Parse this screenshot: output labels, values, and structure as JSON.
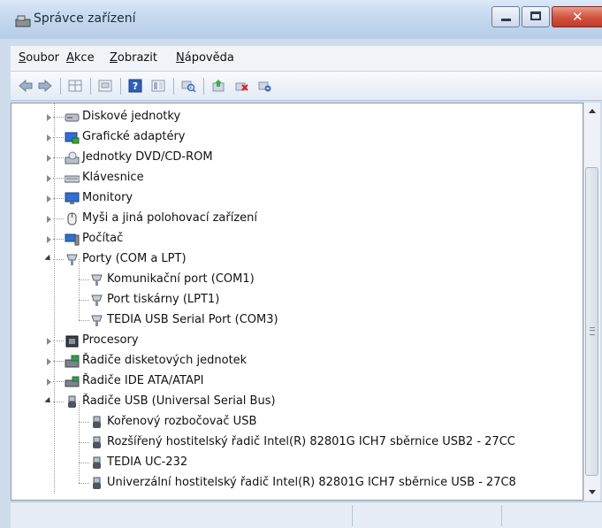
{
  "window": {
    "title": "Správce zařízení"
  },
  "menu": [
    {
      "label": "Soubor",
      "accel_index": 0
    },
    {
      "label": "Akce",
      "accel_index": 0
    },
    {
      "label": "Zobrazit",
      "accel_index": 0
    },
    {
      "label": "Nápověda",
      "accel_index": 0
    }
  ],
  "toolbar": {
    "buttons": [
      "back-arrow-icon",
      "forward-arrow-icon",
      "properties-grid-icon",
      "details-icon",
      "help-icon",
      "view-icon",
      "scan-hardware-icon",
      "update-driver-icon",
      "uninstall-icon",
      "disable-device-icon"
    ]
  },
  "tree": {
    "items": [
      {
        "label": "Diskové jednotky",
        "level": 0,
        "state": "collapsed",
        "icon": "disk-drive-icon"
      },
      {
        "label": "Grafické adaptéry",
        "level": 0,
        "state": "collapsed",
        "icon": "display-adapter-icon"
      },
      {
        "label": "Jednotky DVD/CD-ROM",
        "level": 0,
        "state": "collapsed",
        "icon": "dvd-drive-icon"
      },
      {
        "label": "Klávesnice",
        "level": 0,
        "state": "collapsed",
        "icon": "keyboard-icon"
      },
      {
        "label": "Monitory",
        "level": 0,
        "state": "collapsed",
        "icon": "monitor-icon"
      },
      {
        "label": "Myši a jiná polohovací zařízení",
        "level": 0,
        "state": "collapsed",
        "icon": "mouse-icon"
      },
      {
        "label": "Počítač",
        "level": 0,
        "state": "collapsed",
        "icon": "computer-icon"
      },
      {
        "label": "Porty (COM a LPT)",
        "level": 0,
        "state": "expanded",
        "icon": "port-icon"
      },
      {
        "label": "Komunikační port (COM1)",
        "level": 1,
        "state": "leaf",
        "icon": "port-icon"
      },
      {
        "label": "Port tiskárny (LPT1)",
        "level": 1,
        "state": "leaf",
        "icon": "port-icon"
      },
      {
        "label": "TEDIA USB Serial Port (COM3)",
        "level": 1,
        "state": "leaf",
        "icon": "port-icon",
        "highlight": true
      },
      {
        "label": "Procesory",
        "level": 0,
        "state": "collapsed",
        "icon": "processor-icon"
      },
      {
        "label": "Řadiče disketových jednotek",
        "level": 0,
        "state": "collapsed",
        "icon": "floppy-controller-icon"
      },
      {
        "label": "Řadiče IDE ATA/ATAPI",
        "level": 0,
        "state": "collapsed",
        "icon": "ide-controller-icon"
      },
      {
        "label": "Řadiče USB (Universal Serial Bus)",
        "level": 0,
        "state": "expanded",
        "icon": "usb-icon"
      },
      {
        "label": "Kořenový rozbočovač USB",
        "level": 1,
        "state": "leaf",
        "icon": "usb-icon"
      },
      {
        "label": "Rozšířený hostitelský řadič Intel(R) 82801G ICH7 sběrnice USB2 - 27CC",
        "level": 1,
        "state": "leaf",
        "icon": "usb-icon"
      },
      {
        "label": "TEDIA UC-232",
        "level": 1,
        "state": "leaf",
        "icon": "usb-icon",
        "highlight": true
      },
      {
        "label": "Univerzální hostitelský řadič Intel(R) 82801G ICH7 sběrnice USB - 27C8",
        "level": 1,
        "state": "leaf",
        "icon": "usb-icon"
      }
    ]
  },
  "scrollbar": {
    "position_fraction": 0.13,
    "visible_fraction": 0.85
  }
}
